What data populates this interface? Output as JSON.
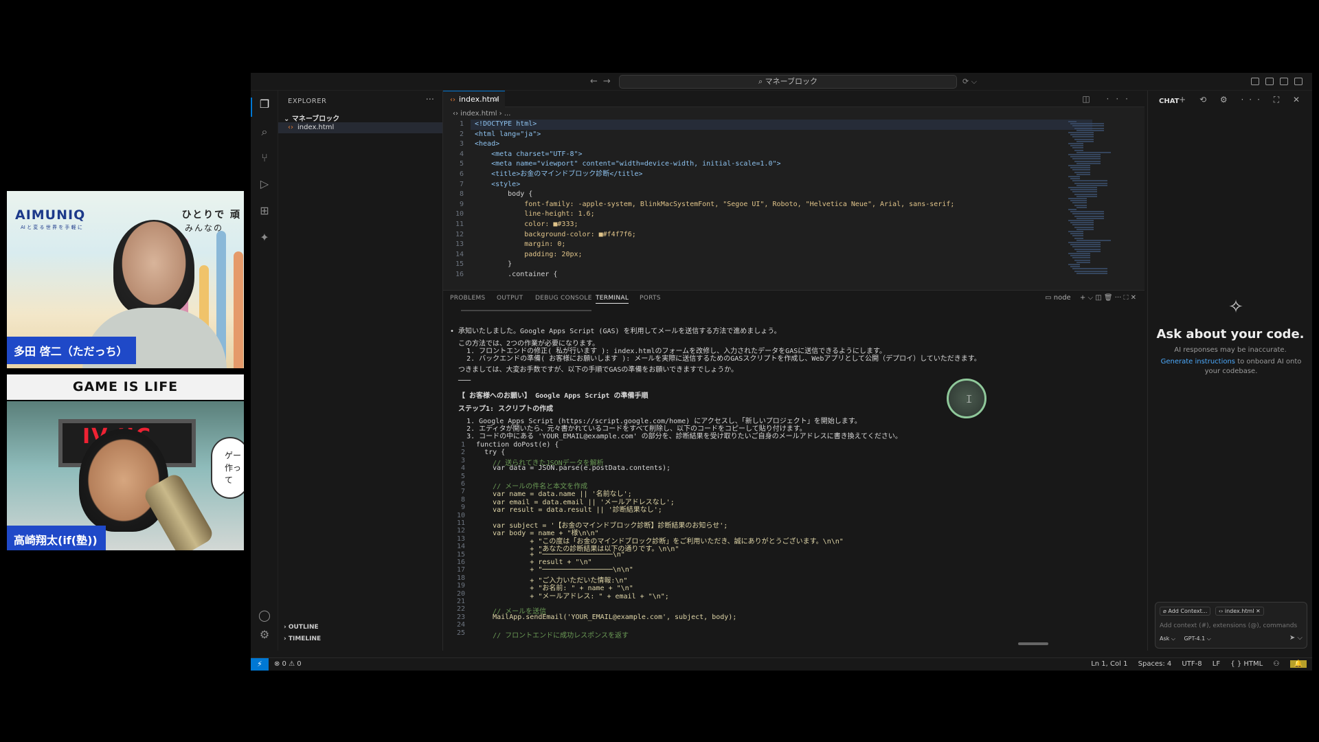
{
  "cam1": {
    "brand": "AIMUNIQ",
    "brand_sub": "AI と 変 る 世 界 を 手 軽 に",
    "tagline_1": "ひとりで 頑",
    "tagline_2": "みんなの",
    "name": "多田 啓二（ただっち）"
  },
  "cam_label": "GAME IS LIFE",
  "cam2": {
    "board_text": "IV  JIC",
    "bubble": "ゲー 作って",
    "name": "高崎翔太(if(塾))"
  },
  "titlebar": {
    "back": "←",
    "forward": "→",
    "command_center": "⌕ マネーブロック",
    "command_extra": "⟳ ⌵"
  },
  "explorer": {
    "title": "EXPLORER",
    "more": "···",
    "folder": "⌄ マネーブロック",
    "file": "index.html",
    "outline": "› OUTLINE",
    "timeline": "› TIMELINE"
  },
  "editor": {
    "tab_label": "index.html",
    "breadcrumb": "‹› index.html › ...",
    "tab_actions": "◫ ···",
    "code_lines": [
      {
        "n": "1",
        "t": "<!DOCTYPE html>"
      },
      {
        "n": "2",
        "t": "<html lang=\"ja\">"
      },
      {
        "n": "3",
        "t": "<head>"
      },
      {
        "n": "4",
        "t": "    <meta charset=\"UTF-8\">"
      },
      {
        "n": "5",
        "t": "    <meta name=\"viewport\" content=\"width=device-width, initial-scale=1.0\">"
      },
      {
        "n": "6",
        "t": "    <title>お金のマインドブロック診断</title>"
      },
      {
        "n": "7",
        "t": "    <style>"
      },
      {
        "n": "8",
        "t": "        body {"
      },
      {
        "n": "9",
        "t": "            font-family: -apple-system, BlinkMacSystemFont, \"Segoe UI\", Roboto, \"Helvetica Neue\", Arial, sans-serif;"
      },
      {
        "n": "10",
        "t": "            line-height: 1.6;"
      },
      {
        "n": "11",
        "t": "            color: ■#333;"
      },
      {
        "n": "12",
        "t": "            background-color: ■#f4f7f6;"
      },
      {
        "n": "13",
        "t": "            margin: 0;"
      },
      {
        "n": "14",
        "t": "            padding: 20px;"
      },
      {
        "n": "15",
        "t": "        }"
      },
      {
        "n": "16",
        "t": "        .container {"
      }
    ]
  },
  "panel": {
    "tabs": [
      "PROBLEMS",
      "OUTPUT",
      "DEBUG CONSOLE",
      "TERMINAL",
      "PORTS"
    ],
    "shell": "▭ node",
    "actions": "+ ⌵  ◫  🗑  ···  ⛶  ✕"
  },
  "terminal": {
    "lines": [
      "• 承知いたしました。Google Apps Script (GAS) を利用してメールを送信する方法で進めましょう。",
      "  この方法では、2つの作業が必要になります。",
      "    1. フロントエンドの修正( 私が行います ): index.htmlのフォームを改修し、入力されたデータをGASに送信できるようにします。",
      "    2. バックエンドの準備( お客様にお願いします ): メールを実際に送信するためのGASスクリプトを作成し、Webアプリとして公開（デプロイ）していただきます。",
      "  つきましては、大変お手数ですが、以下の手順でGASの準備をお願いできますでしょうか。",
      "  ───",
      "  【 お客様へのお願い】 Google Apps Script の準備手順",
      "  ステップ1: スクリプトの作成",
      "    1. Google Apps Script (https://script.google.com/home) にアクセスし、「新しいプロジェクト」を開始します。",
      "    2. エディタが開いたら、元々書かれているコードをすべて削除し、以下のコードをコピーして貼り付けます。",
      "    3. コードの中にある 'YOUR_EMAIL@example.com' の部分を、診断結果を受け取りたいご自身のメールアドレスに書き換えてください。"
    ],
    "code": [
      {
        "n": "1",
        "t": "  function doPost(e) {"
      },
      {
        "n": "2",
        "t": "    try {"
      },
      {
        "n": "3",
        "t": "      // 送られてきたJSONデータを解析"
      },
      {
        "n": "4",
        "t": "      var data = JSON.parse(e.postData.contents);"
      },
      {
        "n": "5",
        "t": ""
      },
      {
        "n": "6",
        "t": "      // メールの件名と本文を作成"
      },
      {
        "n": "7",
        "t": "      var name = data.name || '名前なし';"
      },
      {
        "n": "8",
        "t": "      var email = data.email || 'メールアドレスなし';"
      },
      {
        "n": "9",
        "t": "      var result = data.result || '診断結果なし';"
      },
      {
        "n": "10",
        "t": ""
      },
      {
        "n": "11",
        "t": "      var subject = '【お金のマインドブロック診断】診断結果のお知らせ';"
      },
      {
        "n": "12",
        "t": "      var body = name + \"様\\n\\n\""
      },
      {
        "n": "13",
        "t": "               + \"この度は「お金のマインドブロック診断」をご利用いただき、誠にありがとうございます。\\n\\n\""
      },
      {
        "n": "14",
        "t": "               + \"あなたの診断結果は以下の通りです。\\n\\n\""
      },
      {
        "n": "15",
        "t": "               + \"─────────────────\\n\""
      },
      {
        "n": "16",
        "t": "               + result + \"\\n\""
      },
      {
        "n": "17",
        "t": "               + \"─────────────────\\n\\n\""
      },
      {
        "n": "18",
        "t": "               + \"ご入力いただいた情報:\\n\""
      },
      {
        "n": "19",
        "t": "               + \"お名前: \" + name + \"\\n\""
      },
      {
        "n": "20",
        "t": "               + \"メールアドレス: \" + email + \"\\n\";"
      },
      {
        "n": "21",
        "t": ""
      },
      {
        "n": "22",
        "t": "      // メールを送信"
      },
      {
        "n": "23",
        "t": "      MailApp.sendEmail('YOUR_EMAIL@example.com', subject, body);"
      },
      {
        "n": "24",
        "t": ""
      },
      {
        "n": "25",
        "t": "      // フロントエンドに成功レスポンスを返す"
      }
    ]
  },
  "chat": {
    "title": "CHAT",
    "tools": "+ ⟲ ⚙ ··· ⛶ ✕",
    "heading": "Ask about your code.",
    "warning": "AI responses may be inaccurate.",
    "generate_link": "Generate instructions",
    "generate_rest": " to onboard AI onto your codebase.",
    "add_context": "⌀ Add Context...",
    "file_chip": "‹› index.html ✕",
    "input_placeholder": "Add context (#), extensions (@), commands",
    "mode": "Ask ⌵",
    "model": "GPT-4.1 ⌵",
    "send": "➤ ⌵"
  },
  "statusbar": {
    "remote": "⚡",
    "errors": "⊗ 0 ⚠ 0",
    "position": "Ln 1, Col 1",
    "spaces": "Spaces: 4",
    "encoding": "UTF-8",
    "eol": "LF",
    "language": "{ } HTML",
    "extra": "⚇",
    "bell": "🔔"
  }
}
